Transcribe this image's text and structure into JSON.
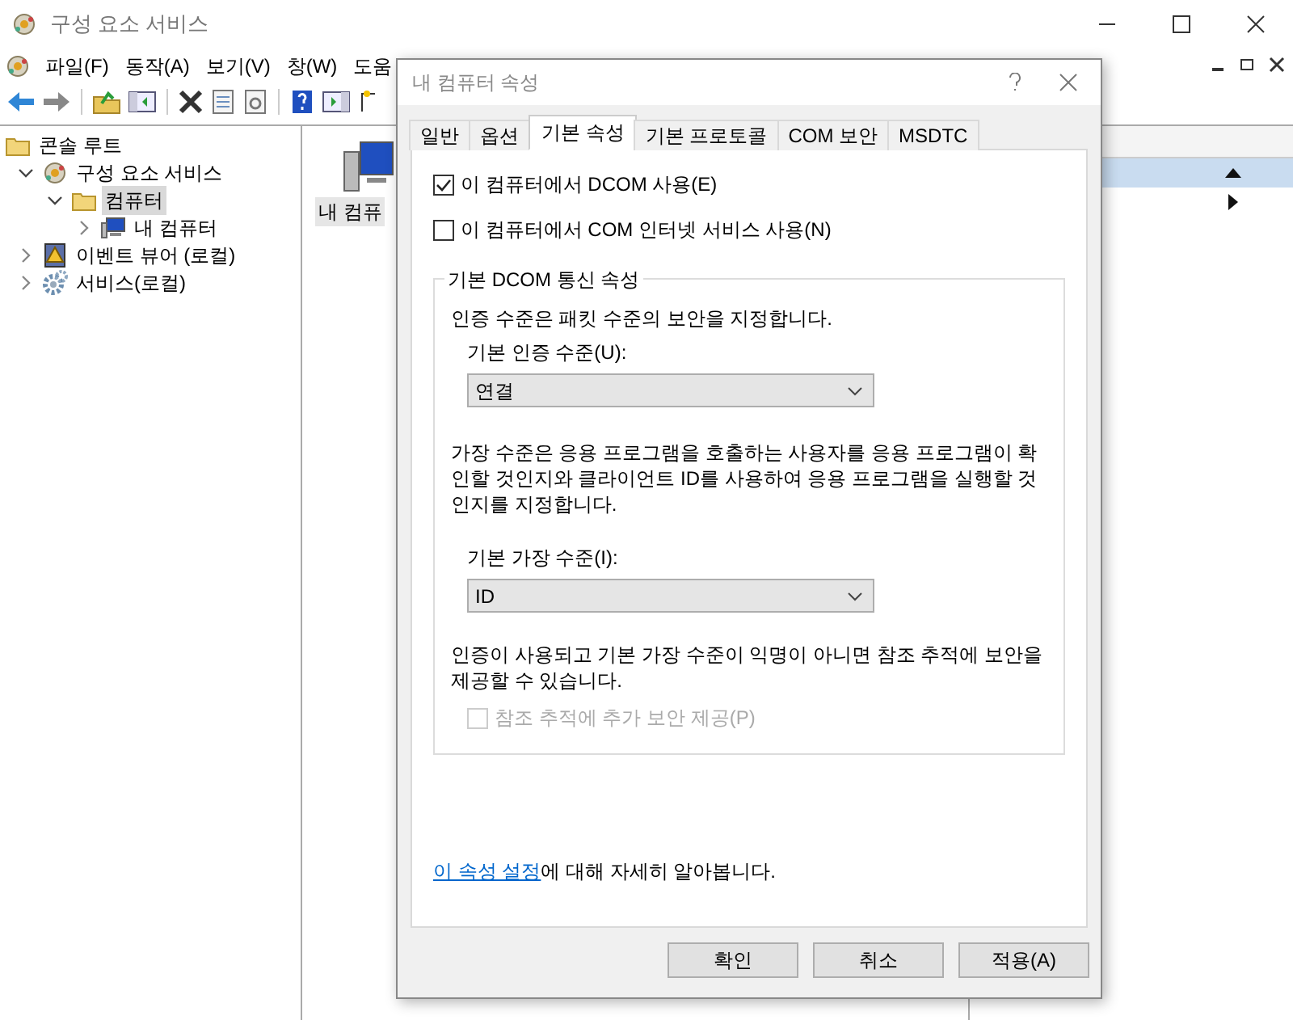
{
  "window": {
    "title": "구성 요소 서비스"
  },
  "menu": [
    "파일(F)",
    "동작(A)",
    "보기(V)",
    "창(W)",
    "도움"
  ],
  "tree": [
    {
      "label": "콘솔 루트",
      "kind": "folder",
      "selected": false,
      "children": [
        {
          "label": "구성 요소 서비스",
          "kind": "component",
          "selected": false,
          "expanded": true,
          "children": [
            {
              "label": "컴퓨터",
              "kind": "folder",
              "selected": true,
              "expanded": true,
              "children": [
                {
                  "label": "내 컴퓨터",
                  "kind": "computer",
                  "selected": false,
                  "expanded": false
                }
              ]
            }
          ]
        },
        {
          "label": "이벤트 뷰어 (로컬)",
          "kind": "event",
          "selected": false,
          "expanded": false
        },
        {
          "label": "서비스(로컬)",
          "kind": "gear",
          "selected": false,
          "expanded": false
        }
      ]
    }
  ],
  "content_items": [
    {
      "label": "내 컴퓨"
    }
  ],
  "dialog": {
    "title": "내 컴퓨터 속성",
    "tabs": [
      {
        "label": "일반",
        "selected": false
      },
      {
        "label": "옵션",
        "selected": false
      },
      {
        "label": "기본 속성",
        "selected": true
      },
      {
        "label": "기본 프로토콜",
        "selected": false
      },
      {
        "label": "COM 보안",
        "selected": false
      },
      {
        "label": "MSDTC",
        "selected": false
      }
    ],
    "checkboxes": [
      {
        "label": "이 컴퓨터에서 DCOM 사용(E)",
        "checked": true,
        "disabled": false
      },
      {
        "label": "이 컴퓨터에서 COM 인터넷 서비스 사용(N)",
        "checked": false,
        "disabled": false
      }
    ],
    "group": {
      "title": "기본 DCOM 통신 속성",
      "auth_description": "인증 수준은 패킷 수준의 보안을 지정합니다.",
      "auth_label": "기본 인증 수준(U):",
      "auth_value": "연결",
      "impersonation_description": "가장 수준은 응용 프로그램을 호출하는 사용자를 응용 프로그램이 확인할 것인지와 클라이언트 ID를 사용하여 응용 프로그램을 실행할 것인지를 지정합니다.",
      "impersonation_label": "기본 가장 수준(I):",
      "impersonation_value": "ID",
      "tracking_description": "인증이 사용되고 기본 가장 수준이 익명이 아니면 참조 추적에 보안을 제공할 수 있습니다.",
      "tracking_checkbox": {
        "label": "참조 추적에 추가 보안 제공(P)",
        "checked": false,
        "disabled": true
      }
    },
    "link": "이 속성 설정",
    "link_suffix": "에 대해 자세히 알아봅니다.",
    "buttons": [
      "확인",
      "취소",
      "적용(A)"
    ]
  }
}
